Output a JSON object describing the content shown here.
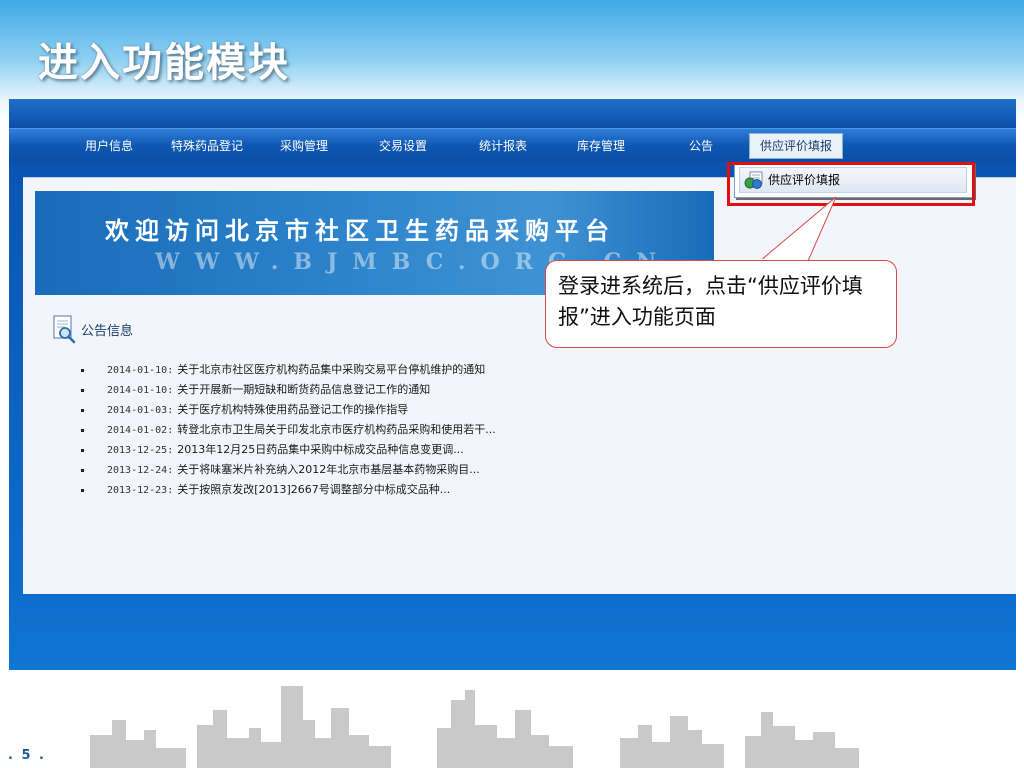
{
  "slide": {
    "title": "进入功能模块",
    "page_number": ". 5 ."
  },
  "navbar": {
    "items": [
      "用户信息",
      "特殊药品登记",
      "采购管理",
      "交易设置",
      "统计报表",
      "库存管理",
      "公告",
      "供应评价填报"
    ],
    "active_index": 7
  },
  "dropdown": {
    "item_label": "供应评价填报",
    "item_icon": "form-globe-icon"
  },
  "banner": {
    "title": "欢迎访问北京市社区卫生药品采购平台",
    "url": "WWW.BJMBC.ORG.CN"
  },
  "notice": {
    "heading": "公告信息",
    "items": [
      {
        "date": "2014-01-10:",
        "text": "关于北京市社区医疗机构药品集中采购交易平台停机维护的通知"
      },
      {
        "date": "2014-01-10:",
        "text": "关于开展新一期短缺和断货药品信息登记工作的通知"
      },
      {
        "date": "2014-01-03:",
        "text": "关于医疗机构特殊使用药品登记工作的操作指导"
      },
      {
        "date": "2014-01-02:",
        "text": "转登北京市卫生局关于印发北京市医疗机构药品采购和使用若干..."
      },
      {
        "date": "2013-12-25:",
        "text": "2013年12月25日药品集中采购中标成交品种信息变更调..."
      },
      {
        "date": "2013-12-24:",
        "text": "关于将味塞米片补充纳入2012年北京市基层基本药物采购目..."
      },
      {
        "date": "2013-12-23:",
        "text": "关于按照京发改[2013]2667号调整部分中标成交品种..."
      }
    ]
  },
  "callout": {
    "text": "登录进系统后，点击“供应评价填报”进入功能页面"
  },
  "colors": {
    "highlight": "#e01010",
    "app_blue": "#0b4fa9",
    "slide_title": "#ffffff"
  }
}
